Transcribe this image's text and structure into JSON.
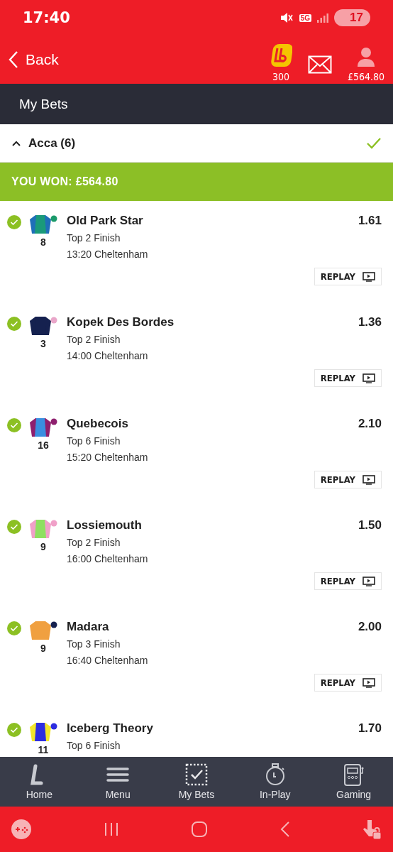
{
  "status_bar": {
    "time": "17:40",
    "network": "5G",
    "battery": "17"
  },
  "header": {
    "back": "Back",
    "points": "300",
    "balance": "£564.80"
  },
  "title": "My Bets",
  "bet": {
    "title": "Acca (6)",
    "expanded": true,
    "settled": true,
    "result": "YOU WON: £564.80"
  },
  "selections": [
    {
      "name": "Old Park Star",
      "number": "8",
      "market": "Top 2 Finish",
      "race": "13:20 Cheltenham",
      "odds": "1.61",
      "replay": "REPLAY",
      "won": true
    },
    {
      "name": "Kopek Des Bordes",
      "number": "3",
      "market": "Top 2 Finish",
      "race": "14:00 Cheltenham",
      "odds": "1.36",
      "replay": "REPLAY",
      "won": true
    },
    {
      "name": "Quebecois",
      "number": "16",
      "market": "Top 6 Finish",
      "race": "15:20 Cheltenham",
      "odds": "2.10",
      "replay": "REPLAY",
      "won": true
    },
    {
      "name": "Lossiemouth",
      "number": "9",
      "market": "Top 2 Finish",
      "race": "16:00 Cheltenham",
      "odds": "1.50",
      "replay": "REPLAY",
      "won": true
    },
    {
      "name": "Madara",
      "number": "9",
      "market": "Top 3 Finish",
      "race": "16:40 Cheltenham",
      "odds": "2.00",
      "replay": "REPLAY",
      "won": true
    },
    {
      "name": "Iceberg Theory",
      "number": "11",
      "market": "Top 6 Finish",
      "odds": "1.70",
      "won": true
    }
  ],
  "bottom_nav": [
    {
      "label": "Home"
    },
    {
      "label": "Menu"
    },
    {
      "label": "My Bets"
    },
    {
      "label": "In-Play"
    },
    {
      "label": "Gaming"
    }
  ]
}
